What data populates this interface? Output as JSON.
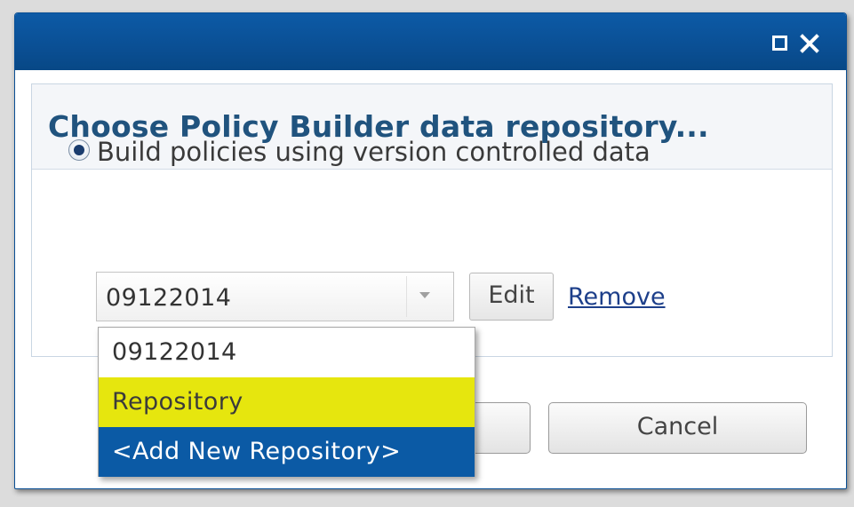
{
  "dialog": {
    "title": "Choose Policy Builder data repository...",
    "titlebar_icons": [
      "maximize-icon",
      "close-icon"
    ],
    "titlebar_color": "#0a4f94"
  },
  "option": {
    "label": "Build policies using version controlled data",
    "selected": true
  },
  "repository_select": {
    "value": "09122014",
    "options": [
      {
        "label": "09122014",
        "state": "normal"
      },
      {
        "label": "Repository",
        "state": "hovered",
        "color": "#e6e60e"
      },
      {
        "label": "<Add New Repository>",
        "state": "selected",
        "color": "#0b5aa5"
      }
    ]
  },
  "actions": {
    "edit_label": "Edit",
    "remove_label": "Remove",
    "cancel_label": "Cancel"
  }
}
